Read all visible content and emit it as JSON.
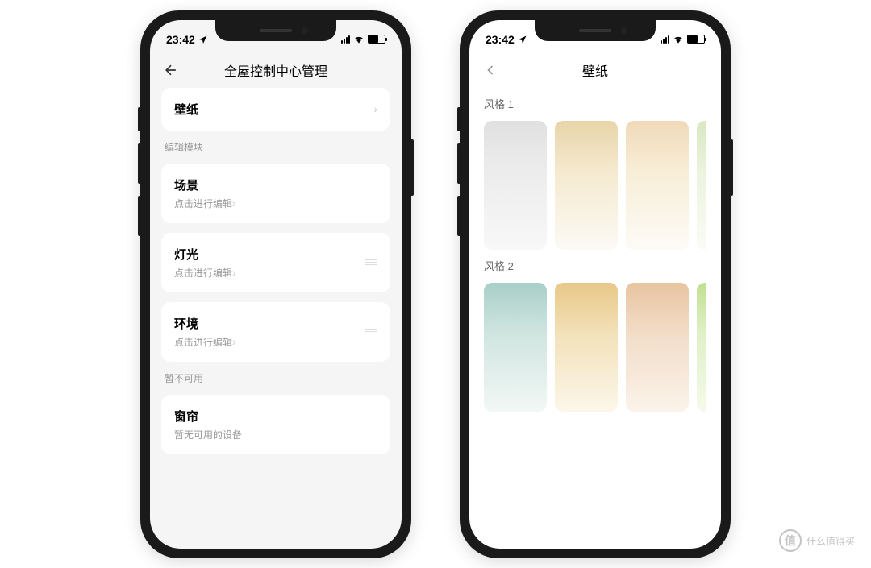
{
  "status": {
    "time": "23:42"
  },
  "left_phone": {
    "nav_title": "全屋控制中心管理",
    "wallpaper_label": "壁纸",
    "section_edit": "编辑模块",
    "section_unavailable": "暂不可用",
    "modules": {
      "scene": {
        "title": "场景",
        "sub": "点击进行编辑"
      },
      "light": {
        "title": "灯光",
        "sub": "点击进行编辑"
      },
      "env": {
        "title": "环境",
        "sub": "点击进行编辑"
      },
      "curtain": {
        "title": "窗帘",
        "sub": "暂无可用的设备"
      }
    }
  },
  "right_phone": {
    "nav_title": "壁纸",
    "style1_label": "风格 1",
    "style2_label": "风格 2"
  },
  "watermark": {
    "symbol": "值",
    "text": "什么值得买"
  }
}
